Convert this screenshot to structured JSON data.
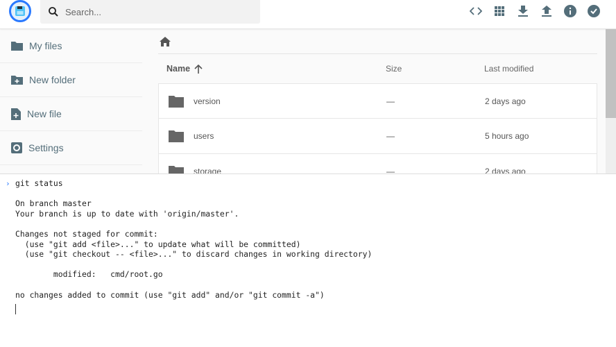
{
  "header": {
    "search_placeholder": "Search...",
    "actions": [
      "code-icon",
      "grid-view-icon",
      "download-icon",
      "upload-icon",
      "info-icon",
      "check-circle-icon"
    ]
  },
  "sidebar": {
    "items": [
      {
        "label": "My files",
        "icon": "folder-icon"
      },
      {
        "label": "New folder",
        "icon": "create-folder-icon"
      },
      {
        "label": "New file",
        "icon": "note-add-icon"
      },
      {
        "label": "Settings",
        "icon": "settings-icon"
      }
    ]
  },
  "listing": {
    "columns": {
      "name": "Name",
      "size": "Size",
      "modified": "Last modified"
    },
    "rows": [
      {
        "name": "version",
        "size": "—",
        "modified": "2 days ago"
      },
      {
        "name": "users",
        "size": "—",
        "modified": "5 hours ago"
      },
      {
        "name": "storage",
        "size": "—",
        "modified": "2 days ago"
      }
    ]
  },
  "terminal": {
    "prompt": "›",
    "command": "git status",
    "output": "On branch master\nYour branch is up to date with 'origin/master'.\n\nChanges not staged for commit:\n  (use \"git add <file>...\" to update what will be committed)\n  (use \"git checkout -- <file>...\" to discard changes in working directory)\n\n        modified:   cmd/root.go\n\nno changes added to commit (use \"git add\" and/or \"git commit -a\")"
  }
}
